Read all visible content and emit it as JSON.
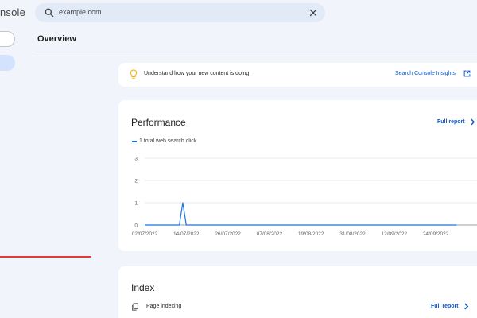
{
  "sidebar": {
    "title": "nsole"
  },
  "search": {
    "value": "example.com"
  },
  "page": {
    "title": "Overview"
  },
  "insights": {
    "text": "Understand how your new content is doing",
    "link": "Search Console Insights"
  },
  "performance": {
    "title": "Performance",
    "full_report": "Full report",
    "legend": "1 total web search click"
  },
  "index": {
    "title": "Index",
    "item": "Page indexing",
    "full_report": "Full report"
  },
  "colors": {
    "accent": "#0b57d0",
    "line": "#1a73e8",
    "annotation": "#e53935"
  },
  "chart_data": {
    "type": "line",
    "title": "",
    "xlabel": "",
    "ylabel": "",
    "ylim": [
      0,
      3
    ],
    "yticks": [
      "0",
      "1",
      "2",
      "3"
    ],
    "xticks": [
      "02/07/2022",
      "14/07/2022",
      "26/07/2022",
      "07/08/2022",
      "19/08/2022",
      "31/08/2022",
      "12/09/2022",
      "24/09/2022"
    ],
    "series": [
      {
        "name": "1 total web search click",
        "x": [
          "2022-07-02",
          "2022-07-12",
          "2022-07-13",
          "2022-07-14",
          "2022-09-30"
        ],
        "values": [
          0,
          0,
          1,
          0,
          0
        ]
      }
    ]
  }
}
